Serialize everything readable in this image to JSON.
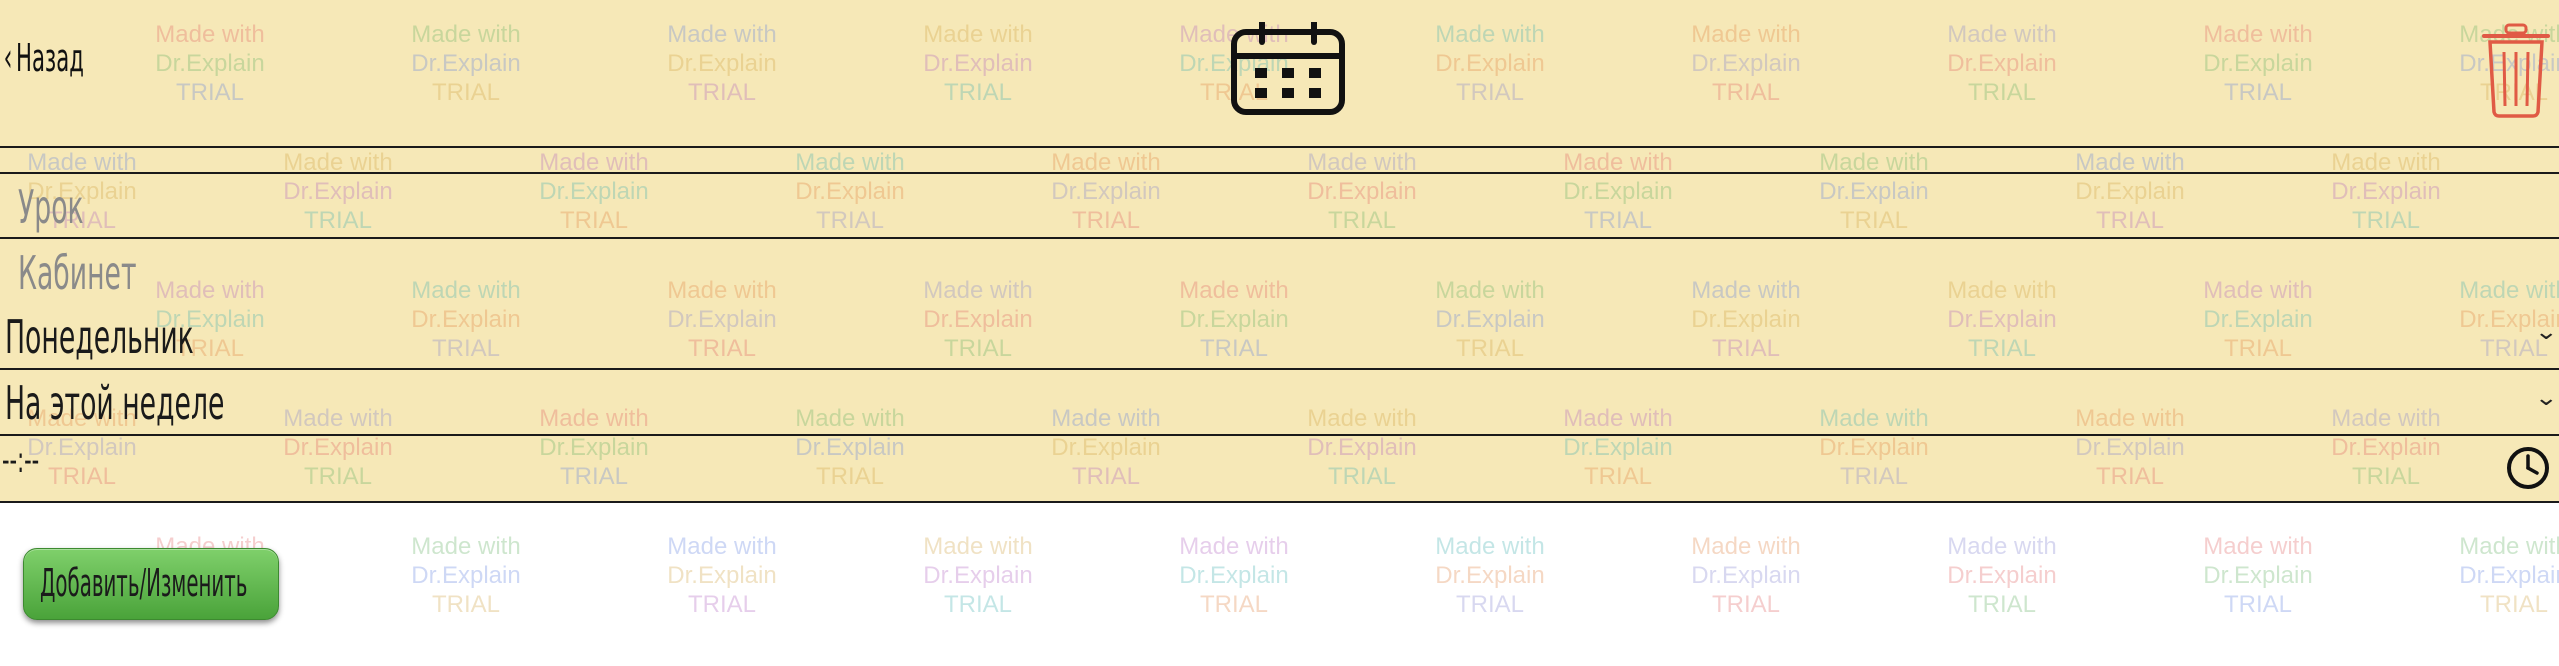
{
  "header": {
    "back_chevron": "‹",
    "back_label": "Назад",
    "calendar_icon": "calendar-icon",
    "trash_icon": "trash-icon"
  },
  "form": {
    "lesson_placeholder": "Урок",
    "room_placeholder": "Кабинет",
    "day_select_value": "Понедельник",
    "week_select_value": "На этой неделе",
    "time_value": "--:--",
    "select_arrow": "⌄"
  },
  "actions": {
    "submit_label": "Добавить/Изменить"
  },
  "watermark": {
    "line1": "Made with",
    "line2": "Dr.Explain",
    "line3": "TRIAL"
  },
  "colors": {
    "background_form": "#f6e8b7",
    "button_green": "#5cb548",
    "trash_red": "#e05a45"
  }
}
